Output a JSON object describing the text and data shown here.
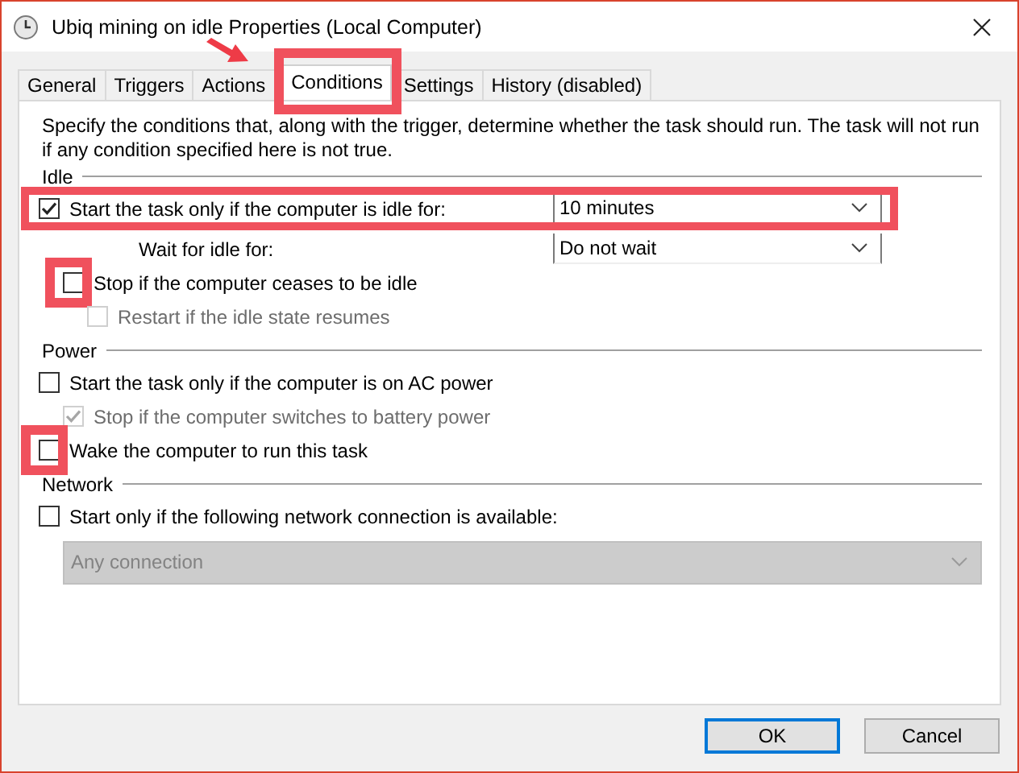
{
  "window": {
    "title": "Ubiq mining on idle Properties (Local Computer)"
  },
  "annotation_arrow": true,
  "tabs": [
    {
      "label": "General",
      "selected": false,
      "highlighted": false
    },
    {
      "label": "Triggers",
      "selected": false,
      "highlighted": false
    },
    {
      "label": "Actions",
      "selected": false,
      "highlighted": false
    },
    {
      "label": "Conditions",
      "selected": true,
      "highlighted": true
    },
    {
      "label": "Settings",
      "selected": false,
      "highlighted": false
    },
    {
      "label": "History (disabled)",
      "selected": false,
      "highlighted": false
    }
  ],
  "description": "Specify the conditions that, along with the trigger, determine whether the task should run.  The task will not run  if any condition specified here is not true.",
  "sections": [
    {
      "heading": "Idle",
      "items": [
        {
          "kind": "checkbox",
          "label": "Start the task only if the computer is idle for:",
          "checked": true,
          "disabled": false,
          "dropdown": "10 minutes",
          "row_highlighted": true,
          "children": [
            {
              "kind": "dropdown",
              "label": "Wait for idle for:",
              "value": "Do not wait",
              "disabled": false
            },
            {
              "kind": "checkbox",
              "label": "Stop if the computer ceases to be idle",
              "checked": false,
              "disabled": false,
              "checkbox_highlighted": true,
              "children": [
                {
                  "kind": "checkbox",
                  "label": "Restart if the idle state resumes",
                  "checked": false,
                  "disabled": true
                }
              ]
            }
          ]
        }
      ]
    },
    {
      "heading": "Power",
      "items": [
        {
          "kind": "checkbox",
          "label": "Start the task only if the computer is on AC power",
          "checked": false,
          "disabled": false,
          "children": [
            {
              "kind": "checkbox",
              "label": "Stop if the computer switches to battery power",
              "checked": true,
              "disabled": true
            }
          ]
        },
        {
          "kind": "checkbox",
          "label": "Wake the computer to run this task",
          "checked": false,
          "disabled": false,
          "checkbox_highlighted": true
        }
      ]
    },
    {
      "heading": "Network",
      "items": [
        {
          "kind": "checkbox",
          "label": "Start only if the following network connection is available:",
          "checked": false,
          "disabled": false,
          "children": [
            {
              "kind": "dropdown",
              "value": "Any connection",
              "disabled": true
            }
          ]
        }
      ]
    }
  ],
  "buttons": [
    {
      "label": "OK",
      "default": true
    },
    {
      "label": "Cancel",
      "default": false
    }
  ]
}
